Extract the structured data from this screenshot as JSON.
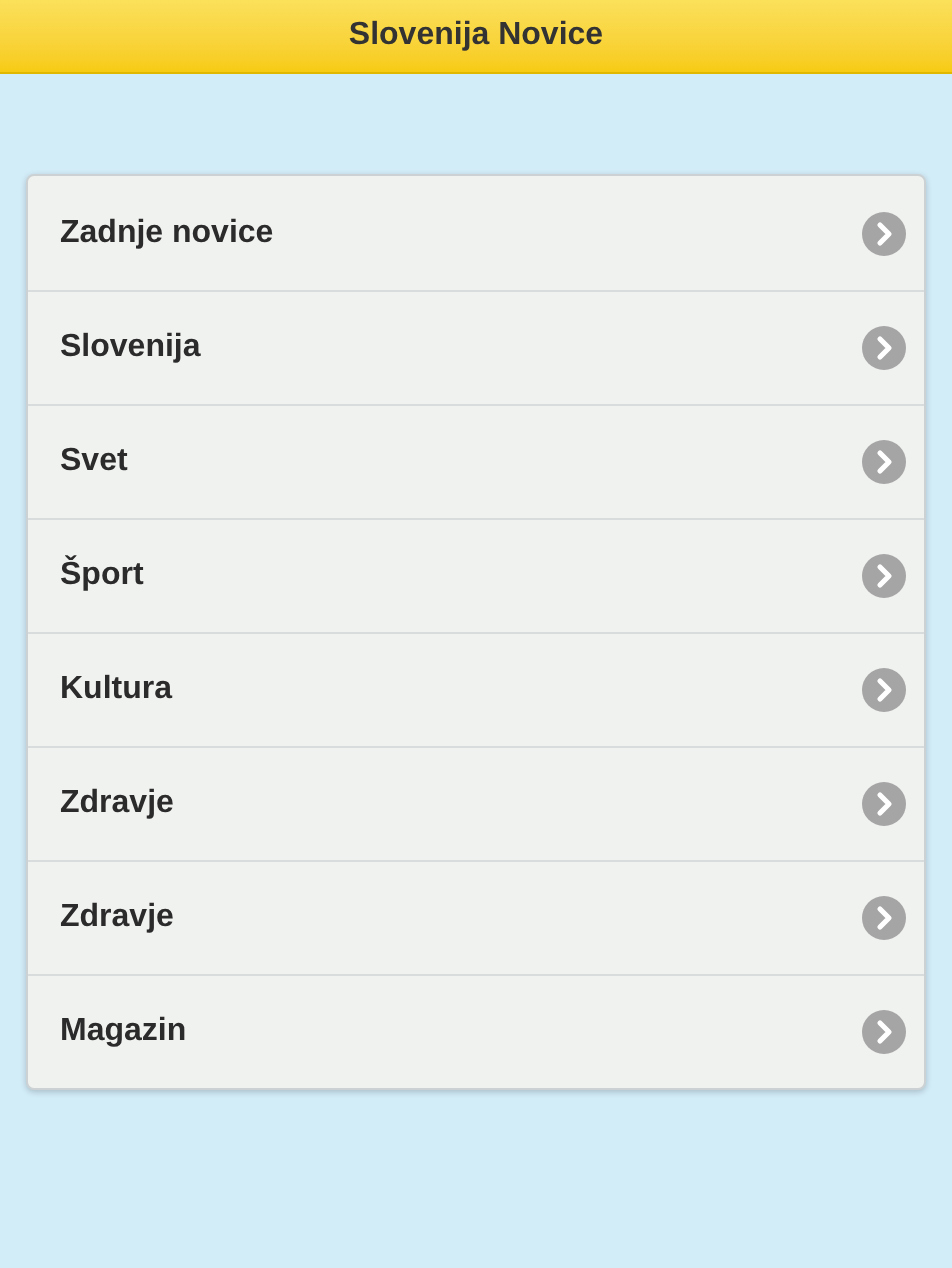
{
  "header": {
    "title": "Slovenija Novice"
  },
  "menu": [
    {
      "label": "Zadnje novice"
    },
    {
      "label": "Slovenija"
    },
    {
      "label": "Svet"
    },
    {
      "label": "Šport"
    },
    {
      "label": "Kultura"
    },
    {
      "label": "Zdravje"
    },
    {
      "label": "Zdravje"
    },
    {
      "label": "Magazin"
    }
  ]
}
